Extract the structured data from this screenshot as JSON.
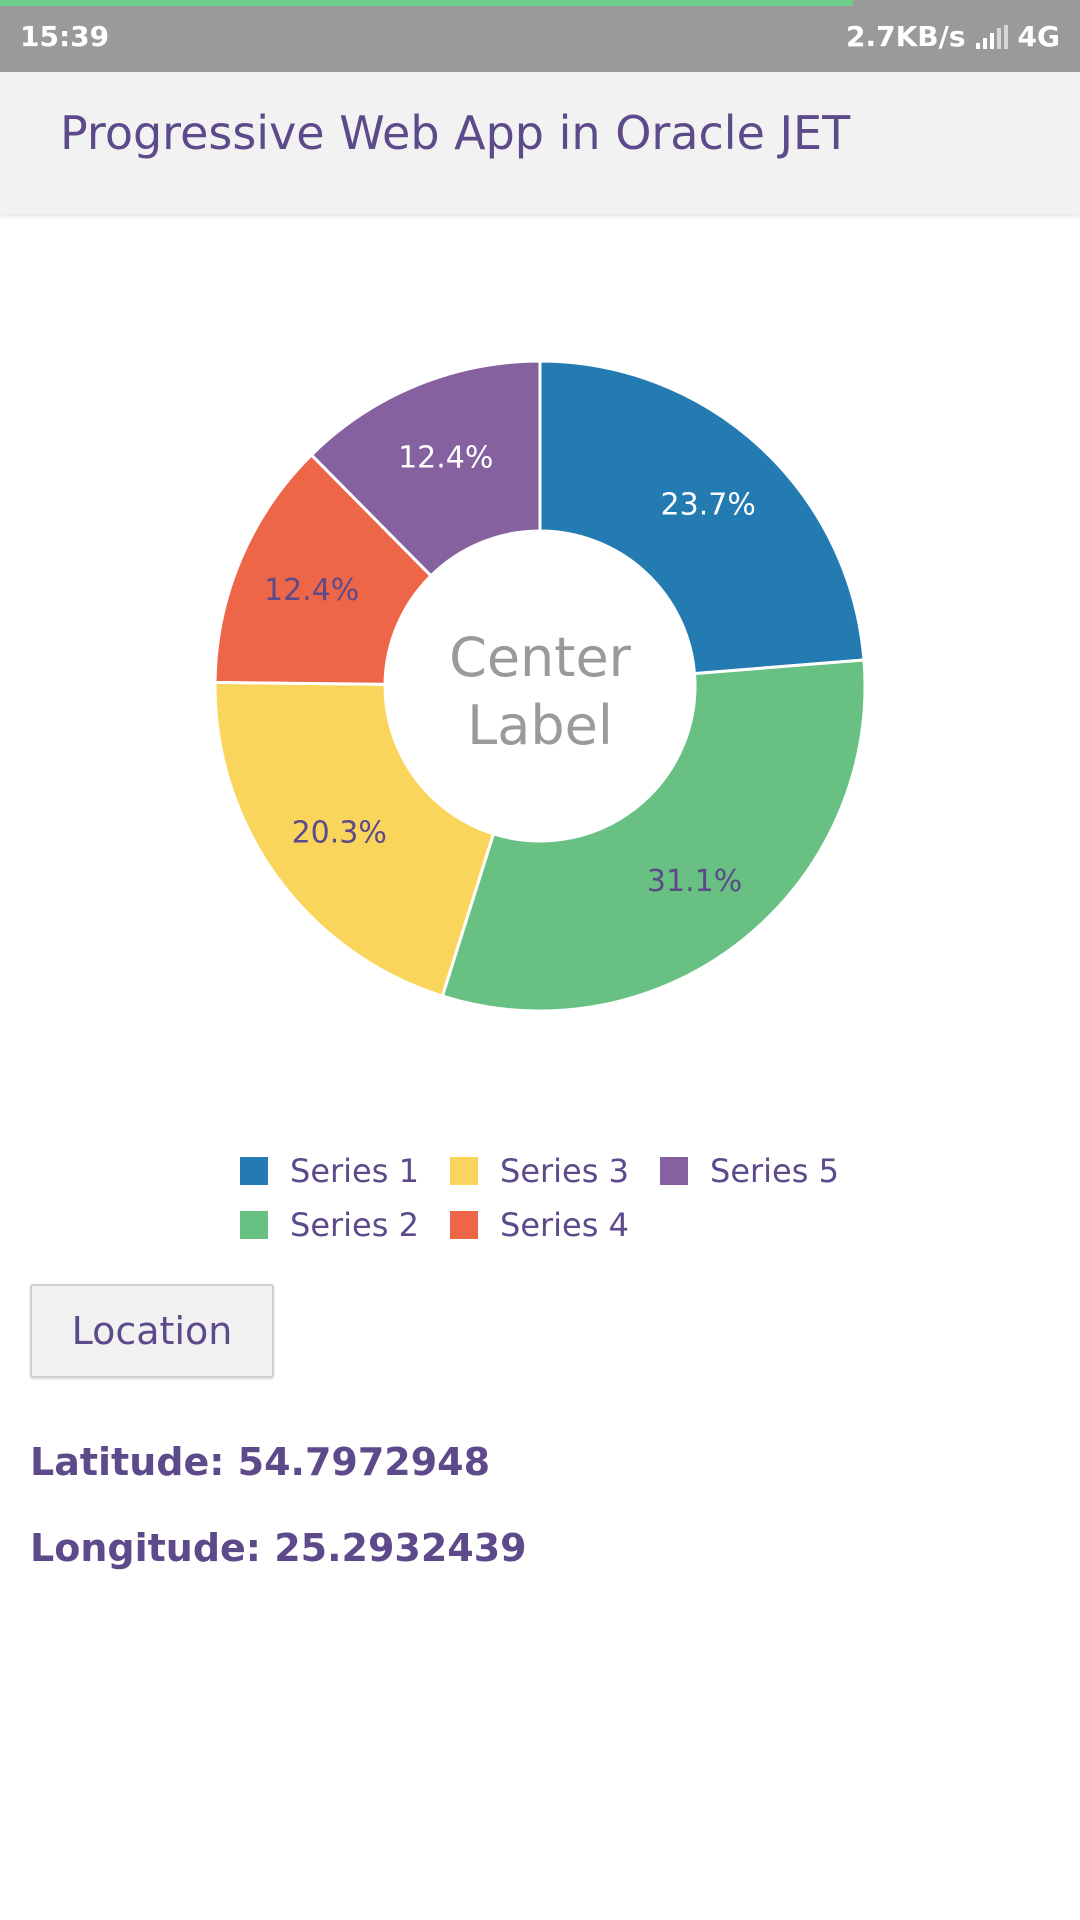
{
  "status_bar": {
    "time": "15:39",
    "network_speed": "2.7KB/s",
    "network_type": "4G",
    "loading_progress": 0.79,
    "signal_icon": "signal-bars-icon"
  },
  "app_bar": {
    "title": "Progressive Web App in Oracle JET"
  },
  "chart_data": {
    "type": "pie",
    "subtype": "donut",
    "center_label": [
      "Center",
      "Label"
    ],
    "slices": [
      {
        "name": "Series 1",
        "value": 23.7,
        "label": "23.7%",
        "color": "#237bb1",
        "label_color": "#ffffff"
      },
      {
        "name": "Series 2",
        "value": 31.1,
        "label": "31.1%",
        "color": "#68c182",
        "label_color": "#5d4a8a"
      },
      {
        "name": "Series 3",
        "value": 20.3,
        "label": "20.3%",
        "color": "#fad55c",
        "label_color": "#5d4a8a"
      },
      {
        "name": "Series 4",
        "value": 12.4,
        "label": "12.4%",
        "color": "#ed6647",
        "label_color": "#5d4a8a"
      },
      {
        "name": "Series 5",
        "value": 12.4,
        "label": "12.4%",
        "color": "#8561a0",
        "label_color": "#ffffff"
      }
    ],
    "legend_placement": "bottom"
  },
  "location": {
    "button_label": "Location",
    "latitude_text": "Latitude: 54.7972948",
    "longitude_text": "Longitude: 25.2932439"
  },
  "colors": {
    "accent_text": "#5d4a8a",
    "center_label": "#9a9a9a"
  }
}
